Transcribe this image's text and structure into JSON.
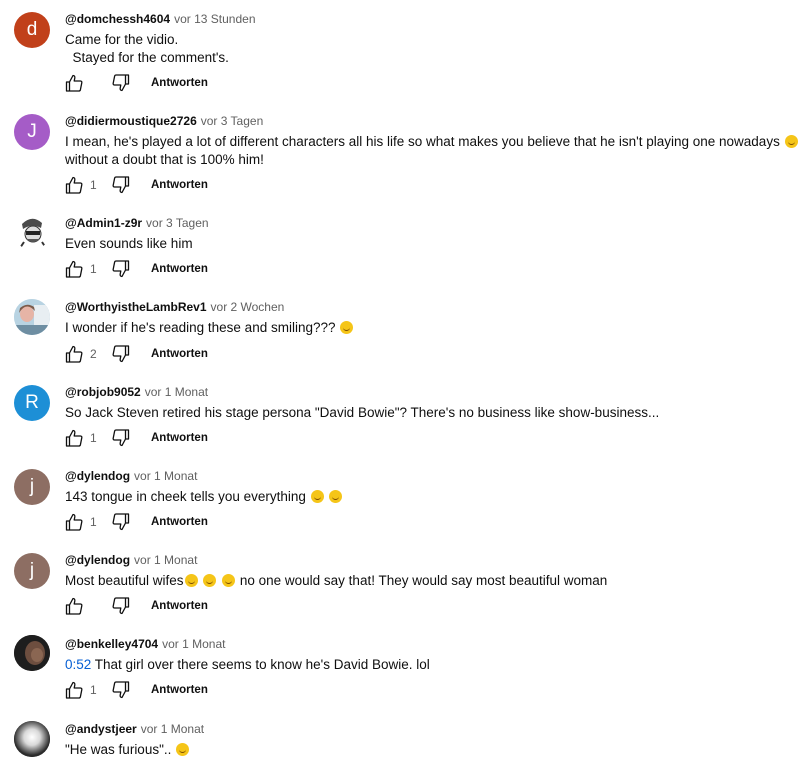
{
  "ui": {
    "reply_label": "Antworten"
  },
  "comments": [
    {
      "handle": "@domchessh4604",
      "time": "vor 13 Stunden",
      "lines": [
        "Came for the vidio.",
        "  Stayed for the comment's."
      ],
      "likes": "",
      "avatar_letter": "d",
      "avatar_color": "#c1401a",
      "avatar_kind": "letter"
    },
    {
      "handle": "@didiermoustique2726",
      "time": "vor 3 Tagen",
      "lines": [
        "I mean, he's played a lot of different characters all his life so what makes you believe that he isn't playing one nowadays",
        "without a doubt that is 100% him!"
      ],
      "likes": "1",
      "avatar_letter": "J",
      "avatar_color": "#a55cc7",
      "avatar_kind": "letter"
    },
    {
      "handle": "@Admin1-z9r",
      "time": "vor 3 Tagen",
      "lines": [
        "Even sounds like him"
      ],
      "likes": "1",
      "avatar_kind": "cartoon-face"
    },
    {
      "handle": "@WorthyistheLambRev1",
      "time": "vor 2 Wochen",
      "lines": [
        "I wonder if he's reading these and smiling???"
      ],
      "likes": "2",
      "avatar_kind": "photo-portrait"
    },
    {
      "handle": "@robjob9052",
      "time": "vor 1 Monat",
      "lines": [
        "So Jack Steven retired his stage persona \"David Bowie\"? There's no business like show-business..."
      ],
      "likes": "1",
      "avatar_letter": "R",
      "avatar_color": "#1d8fd6",
      "avatar_kind": "letter"
    },
    {
      "handle": "@dylendog",
      "time": "vor 1 Monat",
      "lines": [
        "143 tongue in cheek tells you everything"
      ],
      "likes": "1",
      "avatar_letter": "j",
      "avatar_color": "#8d6e63",
      "avatar_kind": "letter"
    },
    {
      "handle": "@dylendog",
      "time": "vor 1 Monat",
      "lines": [
        "Most beautiful wifes",
        "no one would say that! They would say most beautiful woman"
      ],
      "likes": "",
      "avatar_letter": "j",
      "avatar_color": "#8d6e63",
      "avatar_kind": "letter"
    },
    {
      "handle": "@benkelley4704",
      "time": "vor 1 Monat",
      "timestamp": "0:52",
      "lines": [
        "That girl over there seems to know he's David Bowie. lol"
      ],
      "likes": "1",
      "avatar_kind": "photo-dark"
    },
    {
      "handle": "@andystjeer",
      "time": "vor 1 Monat",
      "lines": [
        "\"He was furious\".."
      ],
      "likes": "",
      "avatar_kind": "photo-light"
    }
  ]
}
